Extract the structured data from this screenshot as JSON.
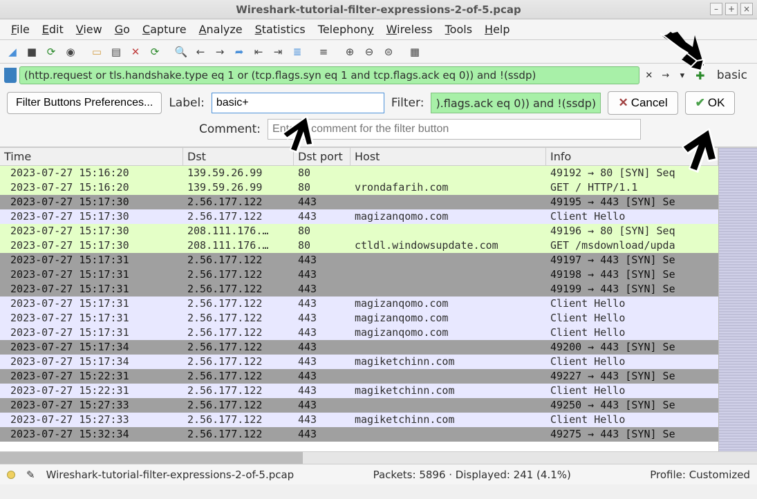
{
  "window": {
    "title": "Wireshark-tutorial-filter-expressions-2-of-5.pcap"
  },
  "menus": [
    "File",
    "Edit",
    "View",
    "Go",
    "Capture",
    "Analyze",
    "Statistics",
    "Telephony",
    "Wireless",
    "Tools",
    "Help"
  ],
  "filter": {
    "expression": "(http.request or tls.handshake.type eq 1 or (tcp.flags.syn eq 1 and tcp.flags.ack eq 0)) and !(ssdp)",
    "basic_label": "basic"
  },
  "filter_button_dialog": {
    "prefs_button": "Filter Buttons Preferences...",
    "label_label": "Label:",
    "label_value": "basic+",
    "filter_label": "Filter:",
    "filter_value": ").flags.ack eq 0)) and !(ssdp)",
    "cancel": "Cancel",
    "ok": "OK",
    "comment_label": "Comment:",
    "comment_placeholder": "Enter a comment for the filter button"
  },
  "columns": {
    "time": "Time",
    "dst": "Dst",
    "port": "Dst port",
    "host": "Host",
    "info": "Info"
  },
  "packets": [
    {
      "cls": "row-green",
      "time": "2023-07-27 15:16:20",
      "dst": "139.59.26.99",
      "port": "80",
      "host": "",
      "info": "49192 → 80 [SYN] Seq"
    },
    {
      "cls": "row-green",
      "time": "2023-07-27 15:16:20",
      "dst": "139.59.26.99",
      "port": "80",
      "host": "vrondafarih.com",
      "info": "GET / HTTP/1.1"
    },
    {
      "cls": "row-gray",
      "time": "2023-07-27 15:17:30",
      "dst": "2.56.177.122",
      "port": "443",
      "host": "",
      "info": "49195 → 443 [SYN] Se"
    },
    {
      "cls": "row-purple",
      "time": "2023-07-27 15:17:30",
      "dst": "2.56.177.122",
      "port": "443",
      "host": "magizanqomo.com",
      "info": "Client Hello"
    },
    {
      "cls": "row-green",
      "time": "2023-07-27 15:17:30",
      "dst": "208.111.176.…",
      "port": "80",
      "host": "",
      "info": "49196 → 80 [SYN] Seq"
    },
    {
      "cls": "row-green",
      "time": "2023-07-27 15:17:30",
      "dst": "208.111.176.…",
      "port": "80",
      "host": "ctldl.windowsupdate.com",
      "info": "GET /msdownload/upda"
    },
    {
      "cls": "row-gray",
      "time": "2023-07-27 15:17:31",
      "dst": "2.56.177.122",
      "port": "443",
      "host": "",
      "info": "49197 → 443 [SYN] Se"
    },
    {
      "cls": "row-gray",
      "time": "2023-07-27 15:17:31",
      "dst": "2.56.177.122",
      "port": "443",
      "host": "",
      "info": "49198 → 443 [SYN] Se"
    },
    {
      "cls": "row-gray",
      "time": "2023-07-27 15:17:31",
      "dst": "2.56.177.122",
      "port": "443",
      "host": "",
      "info": "49199 → 443 [SYN] Se"
    },
    {
      "cls": "row-purple",
      "time": "2023-07-27 15:17:31",
      "dst": "2.56.177.122",
      "port": "443",
      "host": "magizanqomo.com",
      "info": "Client Hello"
    },
    {
      "cls": "row-purple",
      "time": "2023-07-27 15:17:31",
      "dst": "2.56.177.122",
      "port": "443",
      "host": "magizanqomo.com",
      "info": "Client Hello"
    },
    {
      "cls": "row-purple",
      "time": "2023-07-27 15:17:31",
      "dst": "2.56.177.122",
      "port": "443",
      "host": "magizanqomo.com",
      "info": "Client Hello"
    },
    {
      "cls": "row-gray",
      "time": "2023-07-27 15:17:34",
      "dst": "2.56.177.122",
      "port": "443",
      "host": "",
      "info": "49200 → 443 [SYN] Se"
    },
    {
      "cls": "row-purple",
      "time": "2023-07-27 15:17:34",
      "dst": "2.56.177.122",
      "port": "443",
      "host": "magiketchinn.com",
      "info": "Client Hello"
    },
    {
      "cls": "row-gray",
      "time": "2023-07-27 15:22:31",
      "dst": "2.56.177.122",
      "port": "443",
      "host": "",
      "info": "49227 → 443 [SYN] Se"
    },
    {
      "cls": "row-purple",
      "time": "2023-07-27 15:22:31",
      "dst": "2.56.177.122",
      "port": "443",
      "host": "magiketchinn.com",
      "info": "Client Hello"
    },
    {
      "cls": "row-gray",
      "time": "2023-07-27 15:27:33",
      "dst": "2.56.177.122",
      "port": "443",
      "host": "",
      "info": "49250 → 443 [SYN] Se"
    },
    {
      "cls": "row-purple",
      "time": "2023-07-27 15:27:33",
      "dst": "2.56.177.122",
      "port": "443",
      "host": "magiketchinn.com",
      "info": "Client Hello"
    },
    {
      "cls": "row-gray",
      "time": "2023-07-27 15:32:34",
      "dst": "2.56.177.122",
      "port": "443",
      "host": "",
      "info": "49275 → 443 [SYN] Se"
    }
  ],
  "status": {
    "file": "Wireshark-tutorial-filter-expressions-2-of-5.pcap",
    "packets": "Packets: 5896 · Displayed: 241 (4.1%)",
    "profile": "Profile: Customized"
  }
}
